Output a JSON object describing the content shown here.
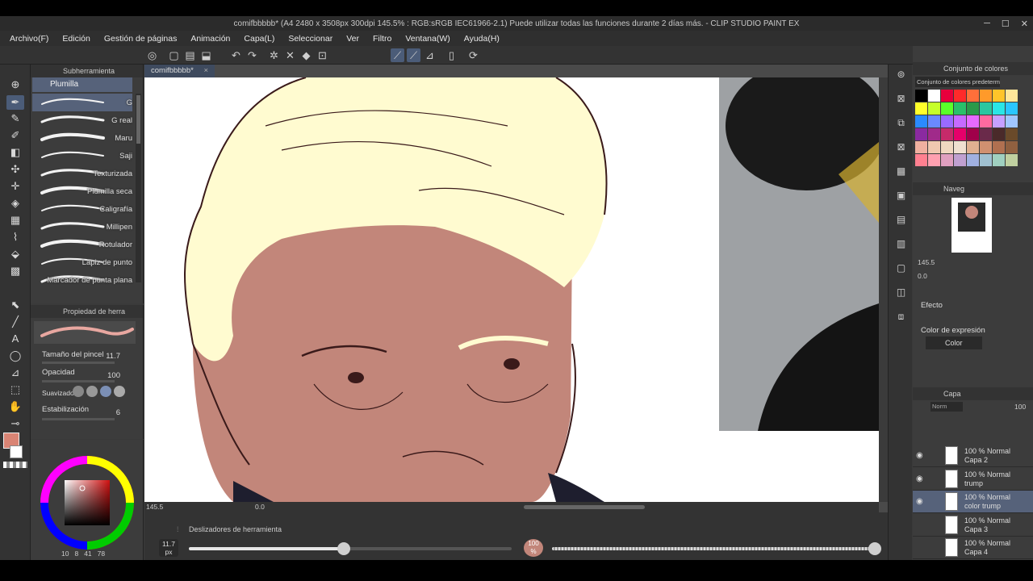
{
  "window": {
    "title": "comifbbbbb* (A4 2480 x 3508px 300dpi 145.5% : RGB:sRGB IEC61966-2.1)  Puede utilizar todas las funciones durante 2 días más. - CLIP STUDIO PAINT EX"
  },
  "menu": [
    "Archivo(F)",
    "Edición",
    "Gestión de páginas",
    "Animación",
    "Capa(L)",
    "Seleccionar",
    "Ver",
    "Filtro",
    "Ventana(W)",
    "Ayuda(H)"
  ],
  "subtool": {
    "header": "Subherramienta",
    "group_tab": "Plumilla",
    "brushes": [
      "G",
      "G real",
      "Maru",
      "Saji",
      "Texturizada",
      "Plumilla seca",
      "Caligrafía",
      "Millipen",
      "Rotulador",
      "Lápiz de punto",
      "Marcador de punta plana"
    ]
  },
  "tool_property": {
    "header": "Propiedad de herra",
    "brush_size_label": "Tamaño del pincel",
    "brush_size_value": "11.7",
    "opacity_label": "Opacidad",
    "opacity_value": "100",
    "smoothing_label": "Suavizado",
    "stabilization_label": "Estabilización",
    "stabilization_value": "6"
  },
  "color_panel": {
    "values": [
      "10",
      "8",
      "41",
      "78"
    ]
  },
  "document": {
    "tab_label": "comifbbbbb*",
    "zoom": "145.5",
    "angle": "0.0"
  },
  "slider_bar": {
    "title": "Deslizadores de herramienta",
    "size_value": "11.7",
    "size_unit": "px",
    "size_level": 0.48,
    "opacity_value": "100",
    "opacity_unit": "%",
    "opacity_level": 1.0
  },
  "color_set": {
    "header": "Conjunto de colores",
    "preset": "Conjunto de colores predeterm"
  },
  "navigator": {
    "header": "Naveg",
    "zoom": "145.5",
    "angle": "0.0"
  },
  "subview": {
    "effect_label": "Efecto",
    "expression_label": "Color de expresión",
    "expression_value": "Color"
  },
  "layers": {
    "header": "Capa",
    "blend_mode": "Norm",
    "opacity": "100",
    "items": [
      {
        "line1": "100 % Normal",
        "line2": "Capa 2"
      },
      {
        "line1": "100 % Normal",
        "line2": "trump"
      },
      {
        "line1": "100 % Normal",
        "line2": "color trump"
      },
      {
        "line1": "100 % Normal",
        "line2": "Capa 3"
      },
      {
        "line1": "100 % Normal",
        "line2": "Capa 4"
      }
    ]
  },
  "colors": {
    "accent": "#56627a",
    "skin": "#c2867a",
    "hair": "#fffbd0",
    "line": "#3a1a1a",
    "main_color": "#d98474"
  }
}
